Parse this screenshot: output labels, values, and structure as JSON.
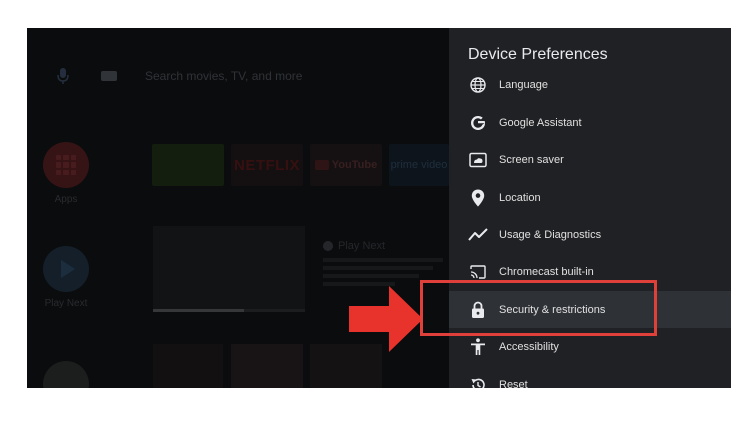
{
  "launcher": {
    "search_placeholder": "Search movies, TV, and more",
    "apps_label": "Apps",
    "play_next_label": "Play Next",
    "tiles": {
      "green": "",
      "netflix": "NETFLIX",
      "youtube": "YouTube",
      "prime": "prime video"
    },
    "play_next_title": "Play Next"
  },
  "panel": {
    "title": "Device Preferences",
    "items": [
      {
        "label": "Language",
        "icon": "globe-icon"
      },
      {
        "label": "Google Assistant",
        "icon": "google-g-icon"
      },
      {
        "label": "Screen saver",
        "icon": "screen-saver-icon"
      },
      {
        "label": "Location",
        "icon": "location-pin-icon"
      },
      {
        "label": "Usage & Diagnostics",
        "icon": "trend-icon"
      },
      {
        "label": "Chromecast built-in",
        "icon": "cast-icon"
      },
      {
        "label": "Security & restrictions",
        "icon": "lock-icon",
        "selected": true
      },
      {
        "label": "Accessibility",
        "icon": "accessibility-icon"
      },
      {
        "label": "Reset",
        "icon": "reset-icon"
      }
    ]
  },
  "annotation": {
    "arrow_color": "#e8332c",
    "highlight_color": "#e0403a"
  }
}
